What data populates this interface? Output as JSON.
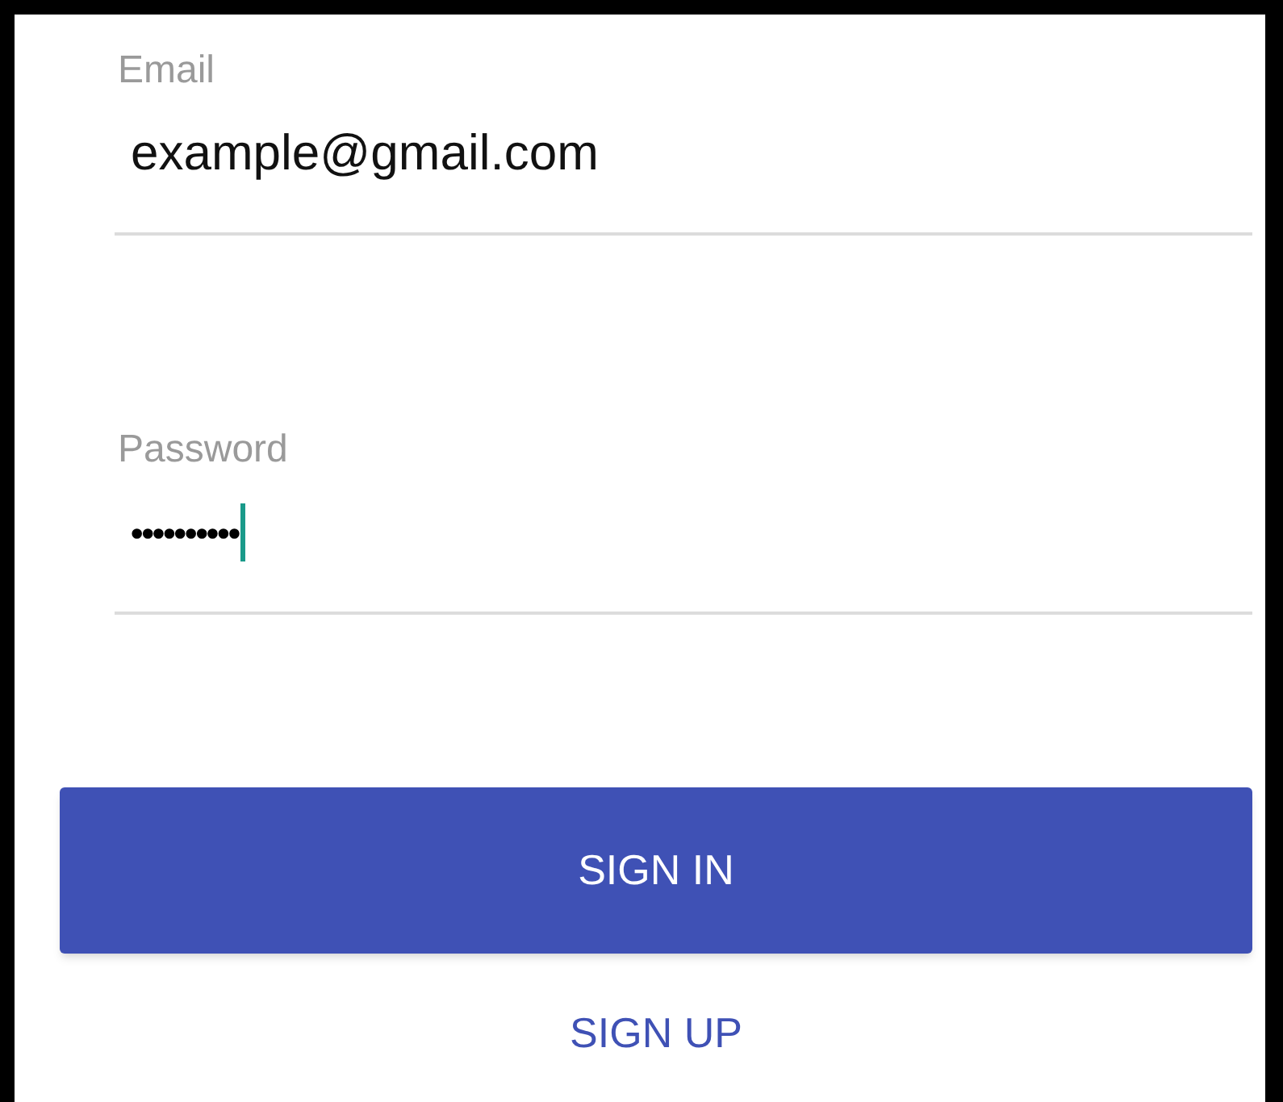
{
  "fields": [
    {
      "label": "Email",
      "value": "example@gmail.com",
      "focused": false
    },
    {
      "label": "Password",
      "value": "••••••••••",
      "focused": true
    }
  ],
  "primary_button": "SIGN IN",
  "secondary_button": "SIGN UP"
}
